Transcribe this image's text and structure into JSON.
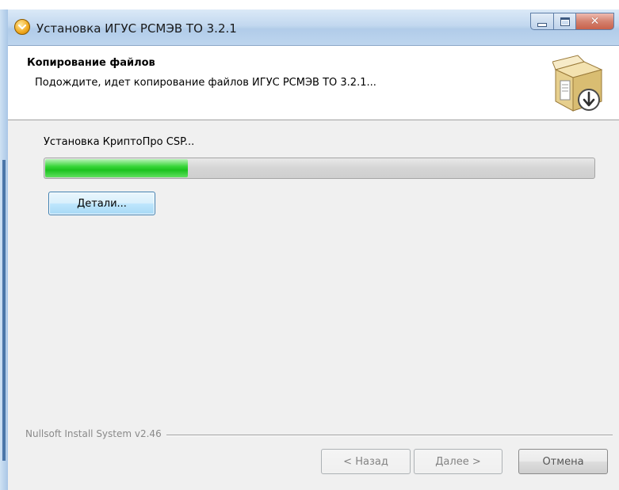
{
  "window": {
    "title": "Установка ИГУС РСМЭВ ТО 3.2.1"
  },
  "header": {
    "title": "Копирование файлов",
    "subtitle": "Подождите, идет копирование файлов ИГУС РСМЭВ ТО 3.2.1..."
  },
  "main": {
    "status_text": "Установка КриптоПро CSP...",
    "progress_percent": 26,
    "details_button": "Детали..."
  },
  "footer": {
    "branding": "Nullsoft Install System v2.46",
    "back_button": "< Назад",
    "next_button": "Далее >",
    "cancel_button": "Отмена"
  },
  "icons": {
    "app": "installer-disc-icon",
    "header": "package-download-icon"
  },
  "colors": {
    "progress_fill": "#1cc21f",
    "titlebar": "#c2d8ef",
    "close_button": "#c8614b"
  }
}
